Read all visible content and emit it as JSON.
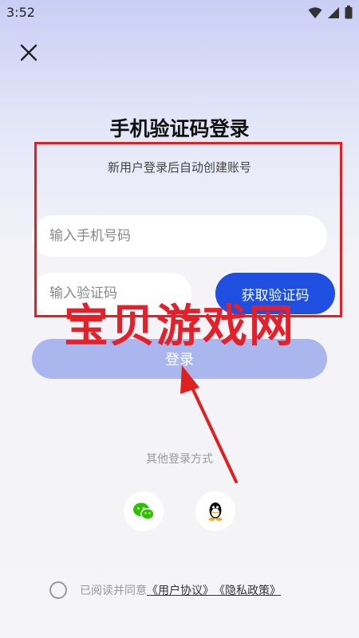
{
  "status_bar": {
    "time": "3:52"
  },
  "header": {
    "close_icon": "close-icon"
  },
  "login": {
    "title": "手机验证码登录",
    "subtitle": "新用户登录后自动创建账号",
    "phone_placeholder": "输入手机号码",
    "phone_value": "",
    "code_placeholder": "输入验证码",
    "code_value": "",
    "get_code_label": "获取验证码",
    "login_label": "登录"
  },
  "other_login": {
    "label": "其他登录方式",
    "options": [
      {
        "name": "wechat",
        "icon": "wechat-icon"
      },
      {
        "name": "qq",
        "icon": "qq-icon"
      }
    ]
  },
  "agreement": {
    "prefix": "已阅读并同意",
    "user_agreement": "《用户协议》",
    "privacy_policy": "《隐私政策》"
  },
  "overlay": {
    "watermark": "宝贝游戏网"
  },
  "colors": {
    "primary": "#1f4fe0",
    "login_disabled": "#aab7ef",
    "highlight": "#e02020",
    "watermark": "#e4202a"
  }
}
